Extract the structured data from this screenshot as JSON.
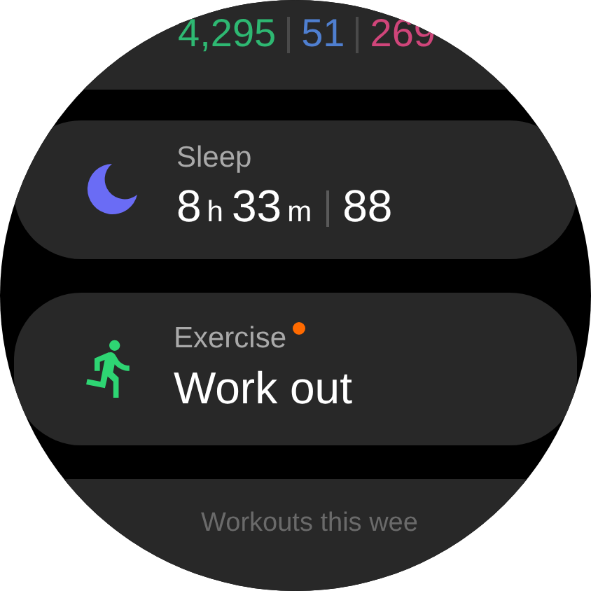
{
  "stats": [
    {
      "value": "4,295",
      "color": "#2eb872"
    },
    {
      "value": "51",
      "color": "#4f7fd0"
    },
    {
      "value": "269",
      "color": "#d0457a"
    }
  ],
  "tiles": [
    {
      "kind": "sleep",
      "title": "Sleep",
      "hours": "8",
      "hours_unit": "h",
      "minutes": "33",
      "minutes_unit": "m",
      "score": "88"
    },
    {
      "kind": "exercise",
      "title": "Exercise",
      "new": true,
      "value": "Work out"
    }
  ],
  "footer": {
    "title": "Workouts this wee"
  }
}
